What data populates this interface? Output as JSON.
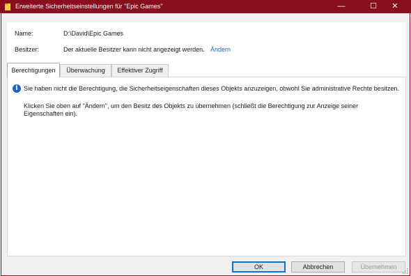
{
  "window": {
    "title": "Erweiterte Sicherheitseinstellungen für \"Epic Games\"",
    "minimize_glyph": "—",
    "maximize_glyph": "☐",
    "close_glyph": "✕",
    "titlebar_color": "#8a0f1e"
  },
  "fields": {
    "name_label": "Name:",
    "name_value": "D:\\David\\Epic Games",
    "owner_label": "Besitzer:",
    "owner_value": "Der aktuelle Besitzer kann nicht angezeigt werden.",
    "change_link": "Ändern"
  },
  "tabs": [
    {
      "label": "Berechtigungen",
      "active": true
    },
    {
      "label": "Überwachung",
      "active": false
    },
    {
      "label": "Effektiver Zugriff",
      "active": false
    }
  ],
  "panel": {
    "info_icon": "info-icon",
    "info_glyph": "i",
    "info_text": "Sie haben nicht die Berechtigung, die Sicherheitseigenschaften dieses Objekts anzuzeigen, obwohl Sie administrative Rechte besitzen.",
    "instruction_text": "Klicken Sie oben auf \"Ändern\", um den Besitz des Objekts zu übernehmen (schließt die Berechtigung zur Anzeige seiner Eigenschaften ein)."
  },
  "buttons": {
    "ok": "OK",
    "cancel": "Abbrechen",
    "apply": "Übernehmen"
  }
}
